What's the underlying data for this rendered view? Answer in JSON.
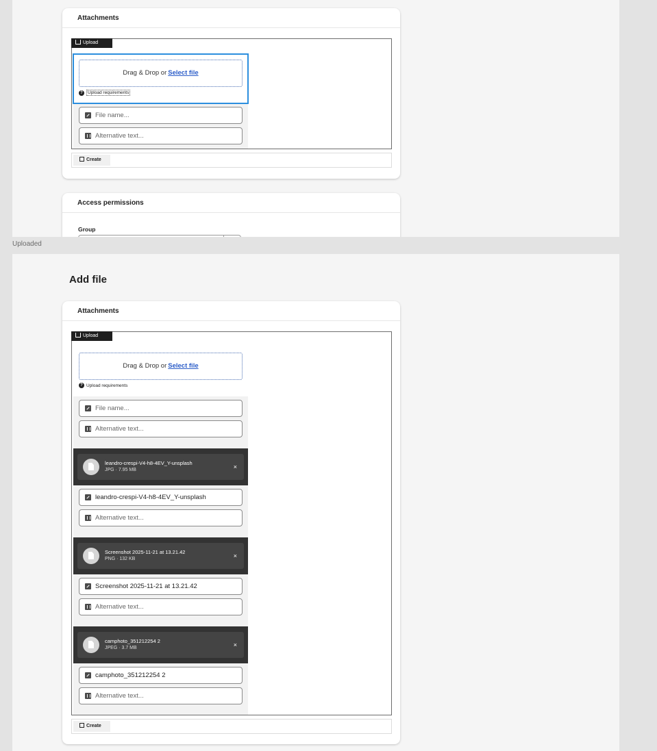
{
  "frame_label": "Uploaded",
  "screen1": {
    "card_title": "Attachments",
    "upload_tag": "Upload",
    "dropzone_text": "Drag & Drop or",
    "select_file": "Select file",
    "upload_requirements": "Upload requirements",
    "file_name_placeholder": "File name...",
    "alt_text_placeholder": "Alternative text...",
    "create_label": "Create",
    "permissions_title": "Access permissions",
    "group_label": "Group"
  },
  "screen2": {
    "page_title": "Add file",
    "card_title": "Attachments",
    "upload_tag": "Upload",
    "dropzone_text": "Drag & Drop or",
    "select_file": "Select file",
    "upload_requirements": "Upload requirements",
    "file_name_placeholder": "File name...",
    "alt_text_placeholder": "Alternative text...",
    "files": [
      {
        "name": "leandro-crespi-V4-h8-4EV_Y-unsplash",
        "meta": "JPG · 7.95 MB",
        "file_name_value": "leandro-crespi-V4-h8-4EV_Y-unsplash",
        "alt_placeholder": "Alternative text..."
      },
      {
        "name": "Screenshot 2025-11-21 at 13.21.42",
        "meta": "PNG · 132 KB",
        "file_name_value": "Screenshot 2025-11-21 at 13.21.42",
        "alt_placeholder": "Alternative text..."
      },
      {
        "name": "camphoto_351212254 2",
        "meta": "JPEG · 3.7 MB",
        "file_name_value": "camphoto_351212254 2",
        "alt_placeholder": "Alternative text..."
      }
    ],
    "close_symbol": "×",
    "create_label": "Create"
  }
}
